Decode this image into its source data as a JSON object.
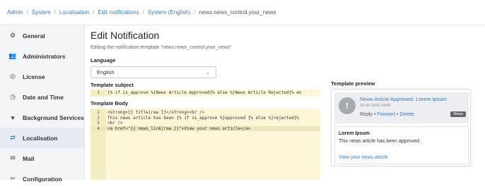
{
  "breadcrumb": [
    "Admin",
    "System",
    "Localisation",
    "Edit notifications",
    "System (English)"
  ],
  "breadcrumb_current": "news.news_control.your_news",
  "sidebar": {
    "items": [
      {
        "label": "General",
        "icon": "gear-icon",
        "active": false
      },
      {
        "label": "Administrators",
        "icon": "users-icon",
        "active": false
      },
      {
        "label": "License",
        "icon": "badge-icon",
        "active": false
      },
      {
        "label": "Date and Time",
        "icon": "clock-icon",
        "active": false
      },
      {
        "label": "Background Services",
        "icon": "heartbeat-icon",
        "active": false
      },
      {
        "label": "Localisation",
        "icon": "translate-icon",
        "active": true
      },
      {
        "label": "Mail",
        "icon": "mail-settings-icon",
        "active": false
      },
      {
        "label": "Configuration",
        "icon": "tools-icon",
        "active": false
      }
    ]
  },
  "main": {
    "title": "Edit Notification",
    "subtitle": "Editing the notification template \"news.news_control.your_news\"",
    "language_label": "Language",
    "language_value": "English",
    "subject_label": "Template subject",
    "subject_line": {
      "num": "1",
      "text": "{% if is_approve %}News Article Approved{% else %}News Article Rejected{% en"
    },
    "body_label": "Template Body",
    "body_lines": [
      {
        "num": "1",
        "text": "<strong>{{ title|raw }}</strong><br />"
      },
      {
        "num": "2",
        "text": "This news article has been {% if is_approve %}approved {% else %}rejected{%"
      },
      {
        "num": "3",
        "text": "<br />"
      },
      {
        "num": "4",
        "text": "<a href=\"{{ news_link|raw }}\">View your news article</a>"
      }
    ]
  },
  "preview": {
    "label": "Template preview",
    "title": "News Article Approved: Lorem Ipsum",
    "date": "25-05-2020 14:00",
    "reply": "Reply",
    "forward": "Forward",
    "delete": "Delete",
    "badge": "News",
    "body_title": "Lorem Ipsum",
    "body_text": "This news article has been approved .",
    "link_text": "View your news article"
  },
  "colors": {
    "accent": "#3c7ac7",
    "code_bg": "#fdf7d7"
  }
}
